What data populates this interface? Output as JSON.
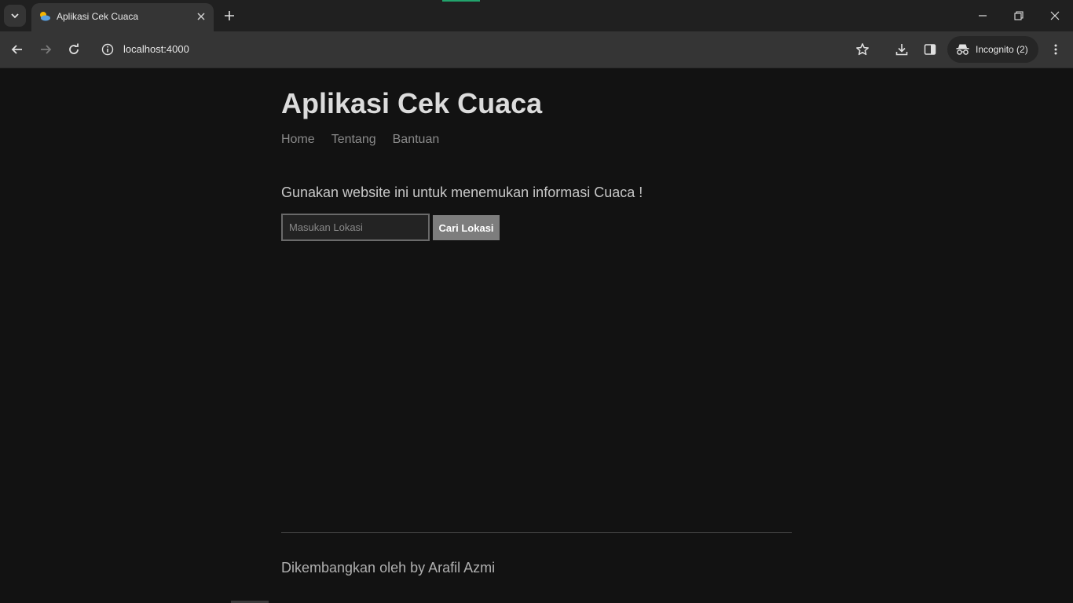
{
  "browser": {
    "tab": {
      "title": "Aplikasi Cek Cuaca",
      "favicon": "weather-favicon-icon"
    },
    "address": {
      "url": "localhost:4000"
    },
    "profile": {
      "label": "Incognito (2)"
    },
    "accent_color": "#22a36c"
  },
  "site": {
    "title": "Aplikasi Cek Cuaca",
    "nav": [
      "Home",
      "Tentang",
      "Bantuan"
    ],
    "intro": "Gunakan website ini untuk menemukan informasi Cuaca !",
    "search": {
      "placeholder": "Masukan Lokasi",
      "value": "",
      "button_label": "Cari Lokasi"
    },
    "footer": "Dikembangkan oleh by Arafil Azmi"
  },
  "colors": {
    "page_bg": "#121212",
    "heading": "#dcdcdc",
    "nav_link": "#8a8a8a",
    "button_bg": "#7d7d7d"
  }
}
